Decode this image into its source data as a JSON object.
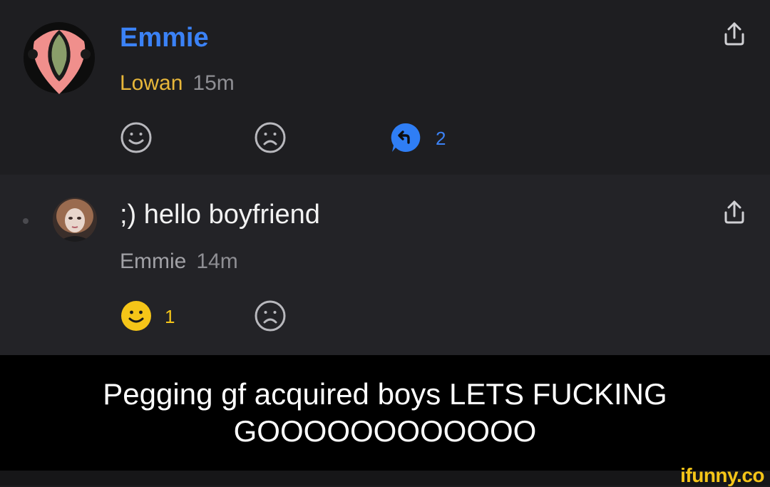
{
  "post": {
    "author": "Emmie",
    "username": "Lowan",
    "time": "15m",
    "reply_count": "2"
  },
  "reply": {
    "text": ";) hello boyfriend",
    "author": "Emmie",
    "time": "14m",
    "like_count": "1"
  },
  "caption": {
    "text": "Pegging gf acquired boys LETS FUCKING GOOOOOOOOOOOO"
  },
  "watermark": "ifunny.co",
  "colors": {
    "author_blue": "#3b82f6",
    "username_yellow": "#e8b73a",
    "like_active": "#f5c518",
    "reply_bubble": "#2f7ef5"
  }
}
